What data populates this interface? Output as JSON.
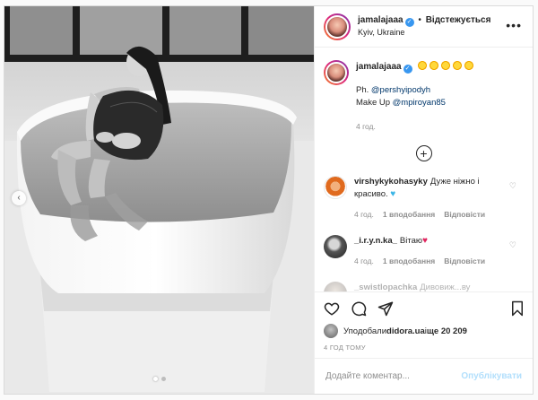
{
  "header": {
    "username": "jamalajaaa",
    "separator": "•",
    "follow_label": "Відстежується",
    "location": "Kyiv, Ukraine",
    "more_icon": "more-horizontal-icon"
  },
  "caption": {
    "username": "jamalajaaa",
    "emoji": "sun-emoji",
    "emoji_count": 5,
    "line1_prefix": "Ph. ",
    "line1_mention": "@pershyipodyh",
    "line2_prefix": "Make Up ",
    "line2_mention": "@mpiroyan85",
    "time": "4 год."
  },
  "load_more_icon": "plus-circle-icon",
  "comments": [
    {
      "username": "virshykykohasyky",
      "text": "Дуже ніжно і красиво.",
      "emoji": "blue-heart",
      "time": "4 год.",
      "likes": "1 вподобання",
      "reply": "Відповісти"
    },
    {
      "username": "_i.r.y.n.ka_",
      "text": "Вітаю",
      "emoji": "red-heart",
      "time": "4 год.",
      "likes": "1 вподобання",
      "reply": "Відповісти"
    },
    {
      "username": "_swistlopachka",
      "text": "Дивовиж...ву"
    }
  ],
  "actions": {
    "like_icon": "heart-icon",
    "comment_icon": "comment-icon",
    "share_icon": "share-icon",
    "save_icon": "bookmark-icon"
  },
  "likes": {
    "prefix": "Уподобали ",
    "user": "didora.ua",
    "middle": " і ",
    "others": "ще 20 209"
  },
  "time_ago": "4 ГОД ТОМУ",
  "add_comment": {
    "placeholder": "Додайте коментар...",
    "post_label": "Опублікувати"
  },
  "carousel": {
    "slide_count": 2,
    "active_index": 0
  },
  "colors": {
    "link": "#00376b",
    "verified": "#3897f0",
    "post_disabled": "#b2dffc",
    "muted": "#8e8e8e"
  }
}
